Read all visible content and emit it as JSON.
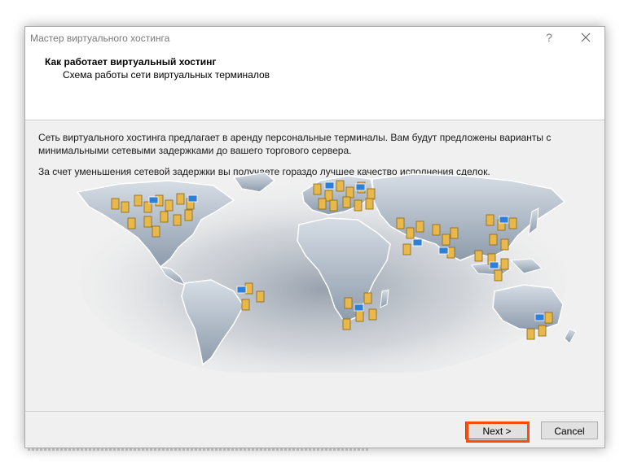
{
  "window": {
    "title": "Мастер виртуального хостинга",
    "help_glyph": "?"
  },
  "header": {
    "title": "Как работает виртуальный хостинг",
    "subtitle": "Схема работы сети виртуальных терминалов"
  },
  "content": {
    "paragraph1": "Сеть виртуального хостинга предлагает в аренду персональные терминалы. Вам будут предложены варианты с минимальными сетевыми задержками до вашего торгового сервера.",
    "paragraph2": "За счет уменьшения сетевой задержки вы получаете гораздо лучшее качество исполнения сделок."
  },
  "buttons": {
    "next": "Next >",
    "cancel": "Cancel"
  },
  "colors": {
    "highlight": "#ff4a0c",
    "server_icon": "#e8b84a",
    "cloud_icon": "#2f7fd6"
  }
}
